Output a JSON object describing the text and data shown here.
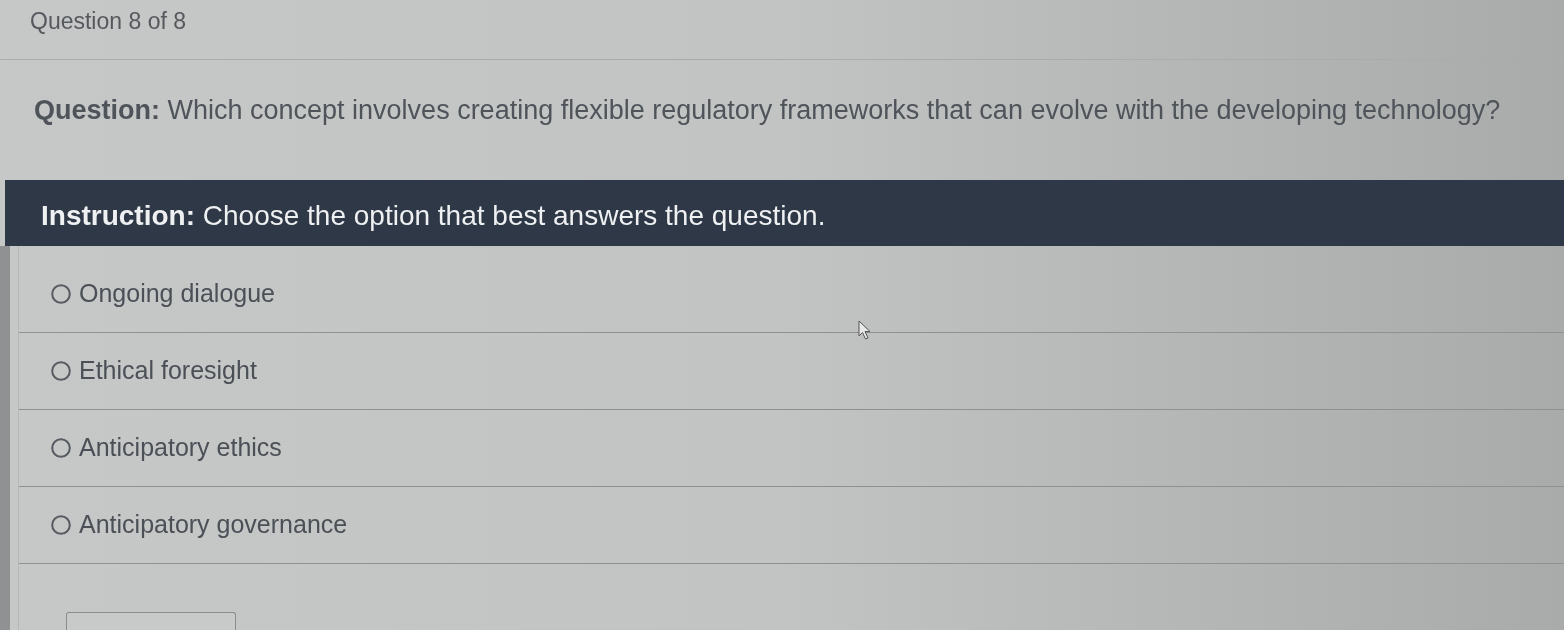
{
  "header": {
    "progress": "Question 8 of 8"
  },
  "question": {
    "text": "**Question:** Which concept involves creating flexible regulatory frameworks that can evolve with the developing technology?"
  },
  "instruction": {
    "text": "**Instruction:** Choose the option that best answers the question."
  },
  "options": [
    {
      "label": "Ongoing dialogue",
      "selected": false
    },
    {
      "label": "Ethical foresight",
      "selected": false
    },
    {
      "label": "Anticipatory ethics",
      "selected": false
    },
    {
      "label": "Anticipatory governance",
      "selected": false
    }
  ]
}
